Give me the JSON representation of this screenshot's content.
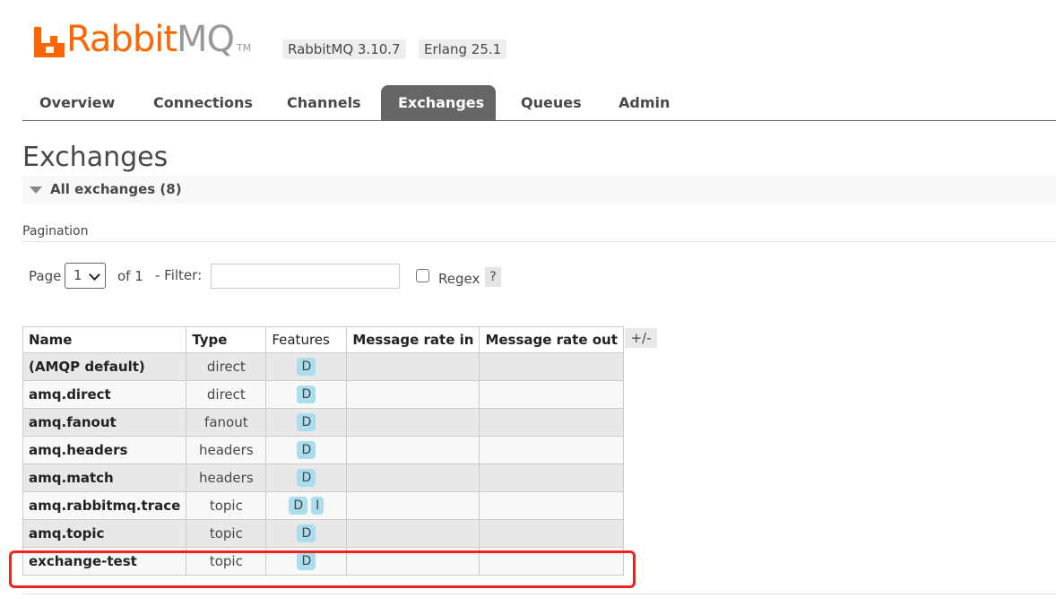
{
  "header": {
    "logo_text_a": "Rabbit",
    "logo_text_b": "MQ",
    "logo_tm": "TM",
    "version": "RabbitMQ 3.10.7",
    "erlang": "Erlang 25.1",
    "brand_color": "#ff6600"
  },
  "nav": {
    "tabs": [
      {
        "label": "Overview"
      },
      {
        "label": "Connections"
      },
      {
        "label": "Channels"
      },
      {
        "label": "Exchanges",
        "active": true
      },
      {
        "label": "Queues"
      },
      {
        "label": "Admin"
      }
    ]
  },
  "page": {
    "title": "Exchanges",
    "section_label": "All exchanges (8)",
    "pagination_label": "Pagination"
  },
  "controls": {
    "page_label": "Page",
    "page_value": "1",
    "of_label": "of 1",
    "filter_label": "- Filter:",
    "filter_value": "",
    "regex_label": "Regex",
    "help_label": "?",
    "plus_minus": "+/-"
  },
  "table": {
    "columns": [
      "Name",
      "Type",
      "Features",
      "Message rate in",
      "Message rate out"
    ],
    "rows": [
      {
        "name": "(AMQP default)",
        "type": "direct",
        "features": [
          "D"
        ]
      },
      {
        "name": "amq.direct",
        "type": "direct",
        "features": [
          "D"
        ]
      },
      {
        "name": "amq.fanout",
        "type": "fanout",
        "features": [
          "D"
        ]
      },
      {
        "name": "amq.headers",
        "type": "headers",
        "features": [
          "D"
        ]
      },
      {
        "name": "amq.match",
        "type": "headers",
        "features": [
          "D"
        ]
      },
      {
        "name": "amq.rabbitmq.trace",
        "type": "topic",
        "features": [
          "D",
          "I"
        ]
      },
      {
        "name": "amq.topic",
        "type": "topic",
        "features": [
          "D"
        ]
      },
      {
        "name": "exchange-test",
        "type": "topic",
        "features": [
          "D"
        ]
      }
    ]
  },
  "highlight_color": "#e8261f"
}
